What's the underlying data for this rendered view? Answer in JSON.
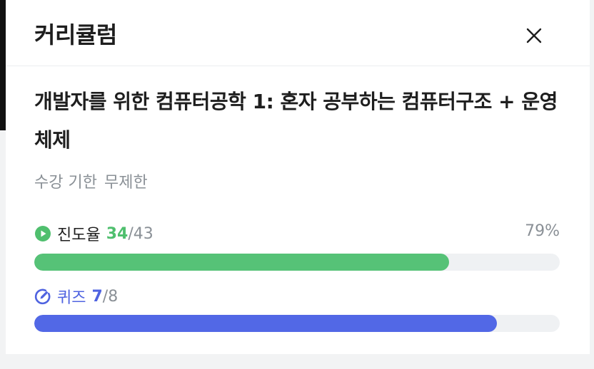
{
  "header": {
    "title": "커리큘럼",
    "close_icon": "close-icon"
  },
  "course": {
    "title": "개발자를 위한 컴퓨터공학 1: 혼자 공부하는 컴퓨터구조 + 운영체제",
    "period_label": "수강 기한",
    "period_value": "무제한"
  },
  "progress": {
    "icon": "play-circle-icon",
    "label": "진도율",
    "done": "34",
    "total": "/43",
    "percent_text": "79%",
    "fraction": 0.79,
    "color": "#56c277"
  },
  "quiz": {
    "icon": "quiz-pencil-icon",
    "label": "퀴즈",
    "done": "7",
    "total": "/8",
    "fraction": 0.88,
    "color": "#5268e6"
  }
}
